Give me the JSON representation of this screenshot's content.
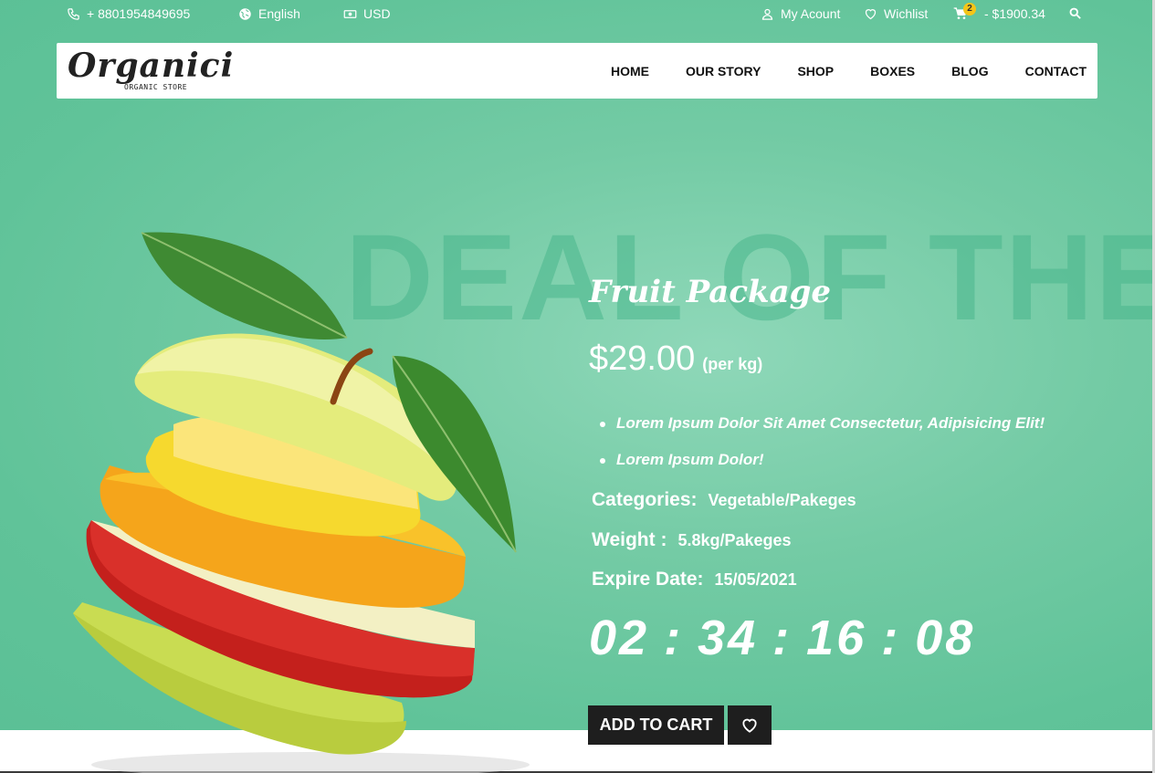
{
  "topbar": {
    "phone": "+ 8801954849695",
    "language": "English",
    "currency": "USD",
    "account": "My Acount",
    "wishlist": "Wichlist",
    "cart_count": "2",
    "cart_total": "- $1900.34",
    "icons": [
      "phone-icon",
      "globe-icon",
      "money-icon",
      "user-icon",
      "heart-icon",
      "cart-icon",
      "search-icon"
    ]
  },
  "nav": {
    "logo_title": "Organici",
    "logo_subtitle": "ORGANIC STORE",
    "items": [
      "HOME",
      "OUR STORY",
      "SHOP",
      "BOXES",
      "BLOG",
      "CONTACT"
    ]
  },
  "hero": {
    "watermark": "DEAL OF THE",
    "title": "Fruit Package",
    "price": "$29.00",
    "price_unit": "(per kg)",
    "bullets": [
      "Lorem Ipsum Dolor Sit Amet Consectetur, Adipisicing Elit!",
      "Lorem Ipsum Dolor!"
    ],
    "categories_label": "Categories:",
    "categories_value": "Vegetable/Pakeges",
    "weight_label": "Weight :",
    "weight_value": "5.8kg/Pakeges",
    "expire_label": "Expire Date:",
    "expire_value": "15/05/2021",
    "countdown": {
      "hours": "02",
      "minutes": "34",
      "seconds": "16",
      "frames": "08",
      "separator": ":"
    },
    "add_to_cart": "ADD TO CART",
    "wishlist_icon": "heart-icon"
  },
  "colors": {
    "hero_bg": "#5bc096",
    "button_bg": "#1e1e1e",
    "badge": "#f5c518"
  }
}
